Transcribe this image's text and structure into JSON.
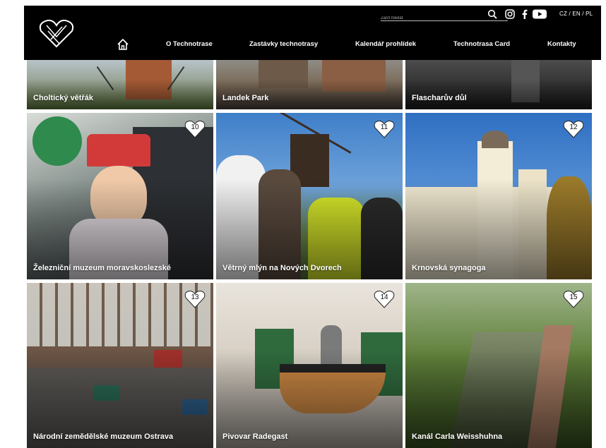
{
  "header": {
    "search_placeholder": "Začít hledat",
    "languages": "CZ / EN / PL",
    "nav": {
      "about": "O Technotrase",
      "stops": "Zastávky technotrasy",
      "calendar": "Kalendář prohlídek",
      "card": "Technotrasa Card",
      "contacts": "Kontakty"
    }
  },
  "colors": {
    "header_bg": "#000000",
    "text_light": "#ffffff",
    "badge_bg": "#ffffff"
  },
  "tiles_top": [
    {
      "title": "Choltický větřák"
    },
    {
      "title": "Landek Park"
    },
    {
      "title": "Flascharův důl"
    }
  ],
  "tiles": [
    {
      "number": "10",
      "title": "Železniční muzeum moravskoslezské"
    },
    {
      "number": "11",
      "title": "Větrný mlýn na Nových Dvorech"
    },
    {
      "number": "12",
      "title": "Krnovská synagoga"
    },
    {
      "number": "13",
      "title": "Národní zemědělské muzeum Ostrava"
    },
    {
      "number": "14",
      "title": "Pivovar Radegast"
    },
    {
      "number": "15",
      "title": "Kanál Carla Weisshuhna"
    }
  ]
}
